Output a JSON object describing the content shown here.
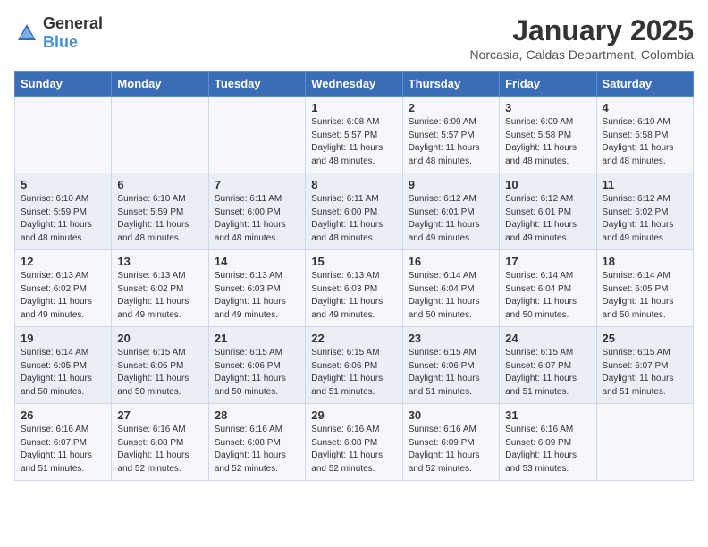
{
  "header": {
    "logo_general": "General",
    "logo_blue": "Blue",
    "title": "January 2025",
    "location": "Norcasia, Caldas Department, Colombia"
  },
  "days_of_week": [
    "Sunday",
    "Monday",
    "Tuesday",
    "Wednesday",
    "Thursday",
    "Friday",
    "Saturday"
  ],
  "weeks": [
    [
      {
        "day": "",
        "info": ""
      },
      {
        "day": "",
        "info": ""
      },
      {
        "day": "",
        "info": ""
      },
      {
        "day": "1",
        "info": "Sunrise: 6:08 AM\nSunset: 5:57 PM\nDaylight: 11 hours and 48 minutes."
      },
      {
        "day": "2",
        "info": "Sunrise: 6:09 AM\nSunset: 5:57 PM\nDaylight: 11 hours and 48 minutes."
      },
      {
        "day": "3",
        "info": "Sunrise: 6:09 AM\nSunset: 5:58 PM\nDaylight: 11 hours and 48 minutes."
      },
      {
        "day": "4",
        "info": "Sunrise: 6:10 AM\nSunset: 5:58 PM\nDaylight: 11 hours and 48 minutes."
      }
    ],
    [
      {
        "day": "5",
        "info": "Sunrise: 6:10 AM\nSunset: 5:59 PM\nDaylight: 11 hours and 48 minutes."
      },
      {
        "day": "6",
        "info": "Sunrise: 6:10 AM\nSunset: 5:59 PM\nDaylight: 11 hours and 48 minutes."
      },
      {
        "day": "7",
        "info": "Sunrise: 6:11 AM\nSunset: 6:00 PM\nDaylight: 11 hours and 48 minutes."
      },
      {
        "day": "8",
        "info": "Sunrise: 6:11 AM\nSunset: 6:00 PM\nDaylight: 11 hours and 48 minutes."
      },
      {
        "day": "9",
        "info": "Sunrise: 6:12 AM\nSunset: 6:01 PM\nDaylight: 11 hours and 49 minutes."
      },
      {
        "day": "10",
        "info": "Sunrise: 6:12 AM\nSunset: 6:01 PM\nDaylight: 11 hours and 49 minutes."
      },
      {
        "day": "11",
        "info": "Sunrise: 6:12 AM\nSunset: 6:02 PM\nDaylight: 11 hours and 49 minutes."
      }
    ],
    [
      {
        "day": "12",
        "info": "Sunrise: 6:13 AM\nSunset: 6:02 PM\nDaylight: 11 hours and 49 minutes."
      },
      {
        "day": "13",
        "info": "Sunrise: 6:13 AM\nSunset: 6:02 PM\nDaylight: 11 hours and 49 minutes."
      },
      {
        "day": "14",
        "info": "Sunrise: 6:13 AM\nSunset: 6:03 PM\nDaylight: 11 hours and 49 minutes."
      },
      {
        "day": "15",
        "info": "Sunrise: 6:13 AM\nSunset: 6:03 PM\nDaylight: 11 hours and 49 minutes."
      },
      {
        "day": "16",
        "info": "Sunrise: 6:14 AM\nSunset: 6:04 PM\nDaylight: 11 hours and 50 minutes."
      },
      {
        "day": "17",
        "info": "Sunrise: 6:14 AM\nSunset: 6:04 PM\nDaylight: 11 hours and 50 minutes."
      },
      {
        "day": "18",
        "info": "Sunrise: 6:14 AM\nSunset: 6:05 PM\nDaylight: 11 hours and 50 minutes."
      }
    ],
    [
      {
        "day": "19",
        "info": "Sunrise: 6:14 AM\nSunset: 6:05 PM\nDaylight: 11 hours and 50 minutes."
      },
      {
        "day": "20",
        "info": "Sunrise: 6:15 AM\nSunset: 6:05 PM\nDaylight: 11 hours and 50 minutes."
      },
      {
        "day": "21",
        "info": "Sunrise: 6:15 AM\nSunset: 6:06 PM\nDaylight: 11 hours and 50 minutes."
      },
      {
        "day": "22",
        "info": "Sunrise: 6:15 AM\nSunset: 6:06 PM\nDaylight: 11 hours and 51 minutes."
      },
      {
        "day": "23",
        "info": "Sunrise: 6:15 AM\nSunset: 6:06 PM\nDaylight: 11 hours and 51 minutes."
      },
      {
        "day": "24",
        "info": "Sunrise: 6:15 AM\nSunset: 6:07 PM\nDaylight: 11 hours and 51 minutes."
      },
      {
        "day": "25",
        "info": "Sunrise: 6:15 AM\nSunset: 6:07 PM\nDaylight: 11 hours and 51 minutes."
      }
    ],
    [
      {
        "day": "26",
        "info": "Sunrise: 6:16 AM\nSunset: 6:07 PM\nDaylight: 11 hours and 51 minutes."
      },
      {
        "day": "27",
        "info": "Sunrise: 6:16 AM\nSunset: 6:08 PM\nDaylight: 11 hours and 52 minutes."
      },
      {
        "day": "28",
        "info": "Sunrise: 6:16 AM\nSunset: 6:08 PM\nDaylight: 11 hours and 52 minutes."
      },
      {
        "day": "29",
        "info": "Sunrise: 6:16 AM\nSunset: 6:08 PM\nDaylight: 11 hours and 52 minutes."
      },
      {
        "day": "30",
        "info": "Sunrise: 6:16 AM\nSunset: 6:09 PM\nDaylight: 11 hours and 52 minutes."
      },
      {
        "day": "31",
        "info": "Sunrise: 6:16 AM\nSunset: 6:09 PM\nDaylight: 11 hours and 53 minutes."
      },
      {
        "day": "",
        "info": ""
      }
    ]
  ]
}
